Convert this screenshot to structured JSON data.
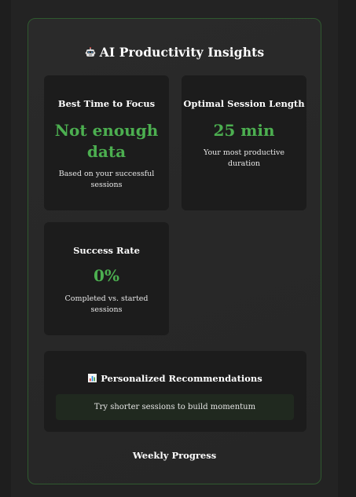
{
  "panel": {
    "title": "AI Productivity Insights",
    "title_icon": "robot-icon"
  },
  "cards": {
    "best_time": {
      "title": "Best Time to Focus",
      "value_line1": "Not enough",
      "value_line2": "data",
      "subtitle_line1": "Based on your successful",
      "subtitle_line2": "sessions"
    },
    "session_length": {
      "title": "Optimal Session Length",
      "value": "25 min",
      "subtitle_line1": "Your most productive",
      "subtitle_line2": "duration"
    },
    "success_rate": {
      "title": "Success Rate",
      "value": "0%",
      "subtitle_line1": "Completed vs. started",
      "subtitle_line2": "sessions"
    }
  },
  "recommendations": {
    "title": "Personalized Recommendations",
    "title_icon": "bar-chart-icon",
    "items": [
      "Try shorter sessions to build momentum"
    ]
  },
  "weekly_progress": {
    "title": "Weekly Progress"
  },
  "colors": {
    "accent": "#4caf50",
    "border": "#2f5a2f",
    "card_bg": "#1c1c1c"
  }
}
